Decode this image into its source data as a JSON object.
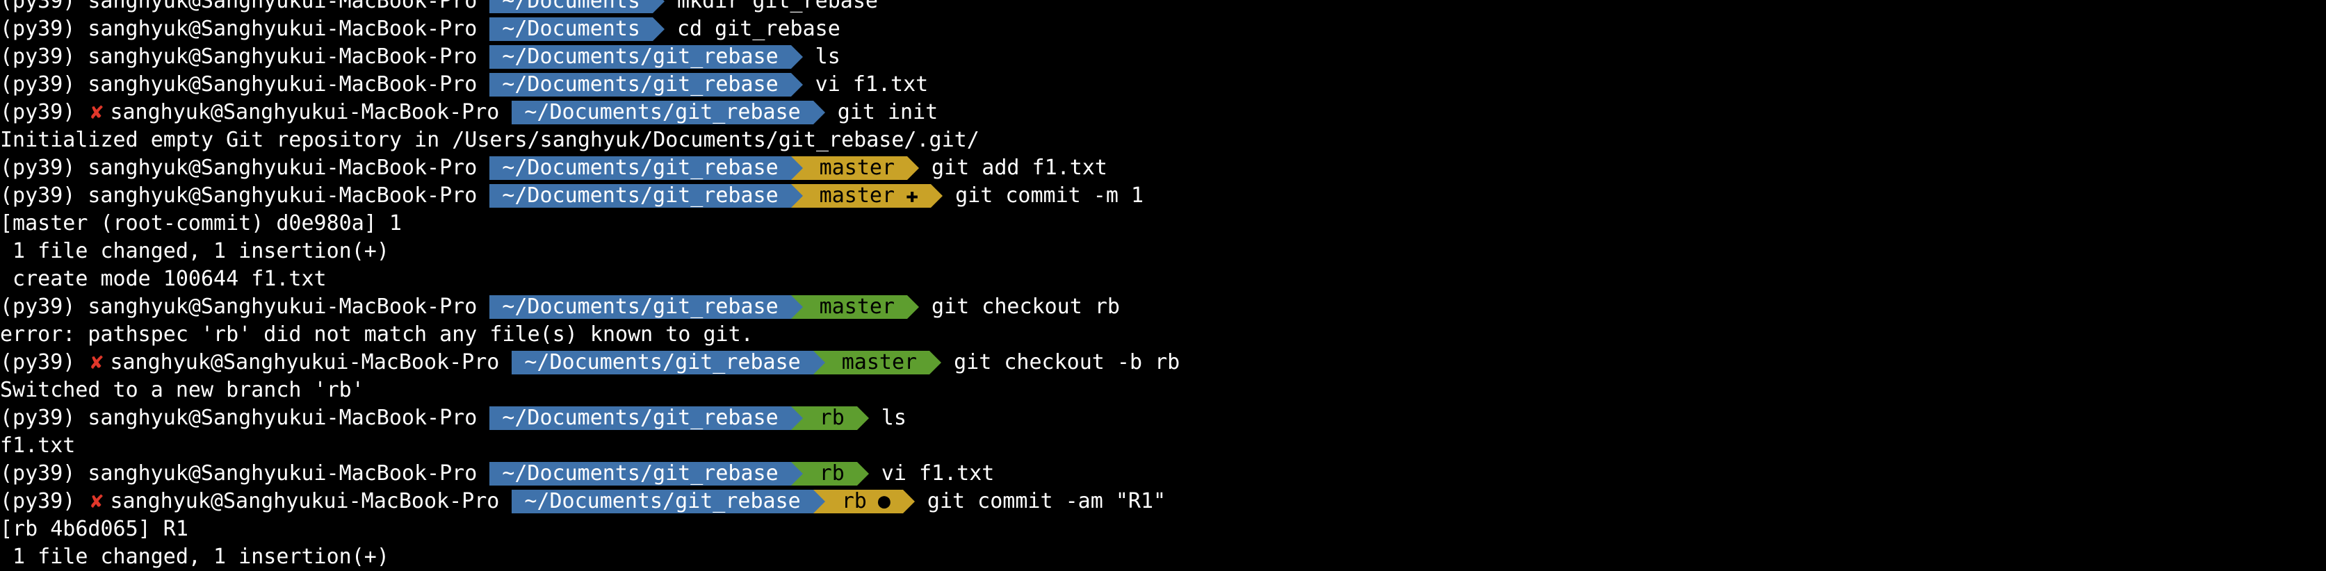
{
  "colors": {
    "background": "#000000",
    "dir_segment": "#3f72ab",
    "branch_clean": "#5e9e2f",
    "branch_dirty": "#c9a227",
    "error_x": "#e0372a"
  },
  "terminal": {
    "env": "(py39)",
    "user": "sanghyuk@Sanghyukui-MacBook-Pro",
    "x_mark": "✘",
    "branch_glyph": "",
    "lines": [
      {
        "kind": "prompt",
        "dir": "~/Documents",
        "cmd": "mkdir git_rebase"
      },
      {
        "kind": "prompt",
        "dir": "~/Documents",
        "cmd": "cd git_rebase"
      },
      {
        "kind": "prompt",
        "dir": "~/Documents/git_rebase",
        "cmd": "ls"
      },
      {
        "kind": "prompt",
        "dir": "~/Documents/git_rebase",
        "cmd": "vi f1.txt"
      },
      {
        "kind": "prompt",
        "x": true,
        "dir": "~/Documents/git_rebase",
        "cmd": "git init"
      },
      {
        "kind": "output",
        "text": "Initialized empty Git repository in /Users/sanghyuk/Documents/git_rebase/.git/"
      },
      {
        "kind": "prompt",
        "dir": "~/Documents/git_rebase",
        "branch": "master",
        "dirty": true,
        "mark": "",
        "cmd": "git add f1.txt"
      },
      {
        "kind": "prompt",
        "dir": "~/Documents/git_rebase",
        "branch": "master",
        "dirty": true,
        "mark": "✚",
        "cmd": "git commit -m 1"
      },
      {
        "kind": "output",
        "text": "[master (root-commit) d0e980a] 1"
      },
      {
        "kind": "output",
        "text": " 1 file changed, 1 insertion(+)"
      },
      {
        "kind": "output",
        "text": " create mode 100644 f1.txt"
      },
      {
        "kind": "prompt",
        "dir": "~/Documents/git_rebase",
        "branch": "master",
        "dirty": false,
        "mark": "",
        "cmd": "git checkout rb"
      },
      {
        "kind": "output",
        "text": "error: pathspec 'rb' did not match any file(s) known to git."
      },
      {
        "kind": "prompt",
        "x": true,
        "dir": "~/Documents/git_rebase",
        "branch": "master",
        "dirty": false,
        "mark": "",
        "cmd": "git checkout -b rb"
      },
      {
        "kind": "output",
        "text": "Switched to a new branch 'rb'"
      },
      {
        "kind": "prompt",
        "dir": "~/Documents/git_rebase",
        "branch": "rb",
        "dirty": false,
        "mark": "",
        "cmd": "ls"
      },
      {
        "kind": "output",
        "text": "f1.txt"
      },
      {
        "kind": "prompt",
        "dir": "~/Documents/git_rebase",
        "branch": "rb",
        "dirty": false,
        "mark": "",
        "cmd": "vi f1.txt"
      },
      {
        "kind": "prompt",
        "x": true,
        "dir": "~/Documents/git_rebase",
        "branch": "rb",
        "dirty": true,
        "mark": "●",
        "cmd": "git commit -am \"R1\""
      },
      {
        "kind": "output",
        "text": "[rb 4b6d065] R1"
      },
      {
        "kind": "output",
        "text": " 1 file changed, 1 insertion(+)"
      }
    ]
  }
}
